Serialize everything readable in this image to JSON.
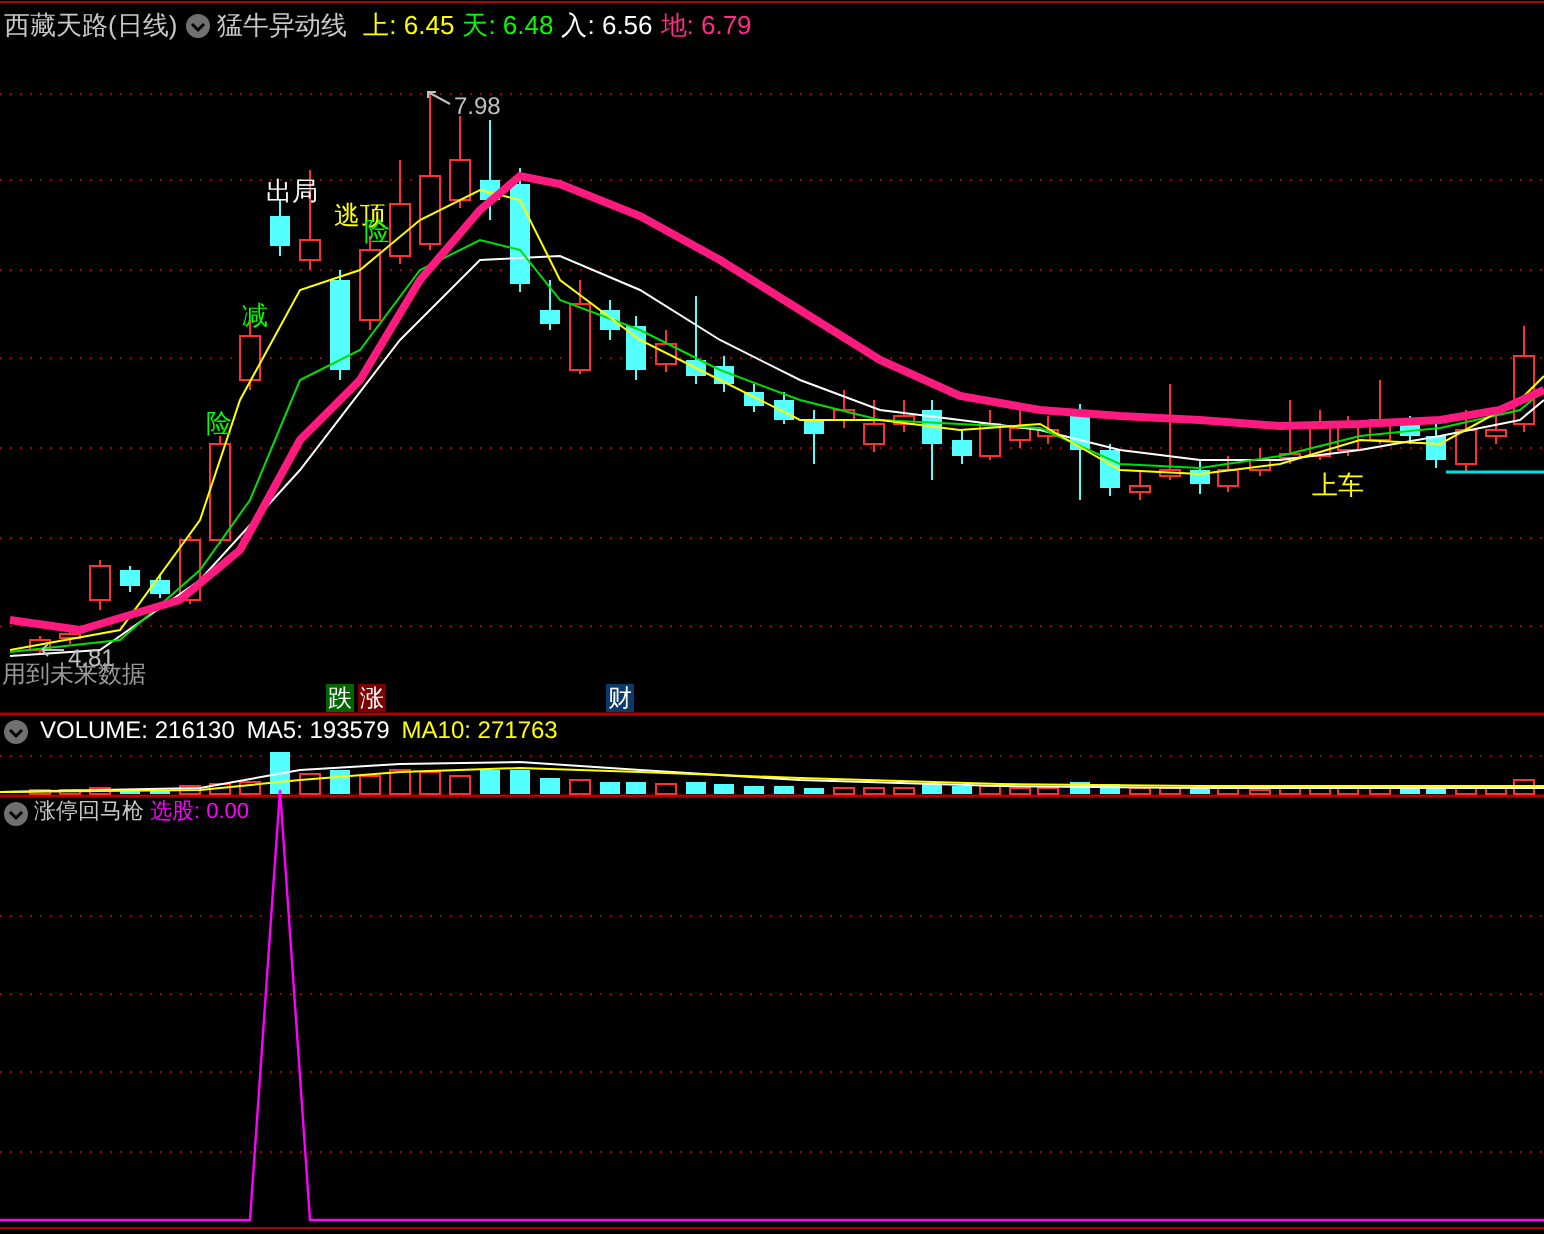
{
  "price_panel": {
    "stock_title": "西藏天路(日线)",
    "indicator_name": "猛牛异动线",
    "readings": [
      {
        "label": "上:",
        "value": "6.45",
        "color": "#ffff00"
      },
      {
        "label": "天:",
        "value": "6.48",
        "color": "#00ff00"
      },
      {
        "label": "入:",
        "value": "6.56",
        "color": "#ffffff"
      },
      {
        "label": "地:",
        "value": "6.79",
        "color": "#ff2a8a"
      }
    ],
    "high_label": "7.98",
    "low_label": "4.81",
    "signals": [
      {
        "text": "出局",
        "color": "#ffffff"
      },
      {
        "text": "逃顶",
        "color": "#ffff00"
      },
      {
        "text": "险",
        "color": "#00ff00"
      },
      {
        "text": "减",
        "color": "#00ff00"
      },
      {
        "text": "险",
        "color": "#00ff00"
      },
      {
        "text": "上车",
        "color": "#ffff00"
      }
    ],
    "warning": "用到未来数据",
    "event_badges": [
      {
        "text": "跌",
        "color": "#006400"
      },
      {
        "text": "涨",
        "color": "#7a0000"
      },
      {
        "text": "财",
        "color": "#0a3a6a"
      }
    ]
  },
  "volume_panel": {
    "readings": [
      {
        "label": "VOLUME:",
        "value": "216130",
        "color": "#ffffff"
      },
      {
        "label": "MA5:",
        "value": "193579",
        "color": "#ffffff"
      },
      {
        "label": "MA10:",
        "value": "271763",
        "color": "#ffff00"
      }
    ]
  },
  "indicator_panel": {
    "name": "涨停回马枪",
    "readings": [
      {
        "label": "选股:",
        "value": "0.00",
        "color": "#ff00ff"
      }
    ]
  }
}
